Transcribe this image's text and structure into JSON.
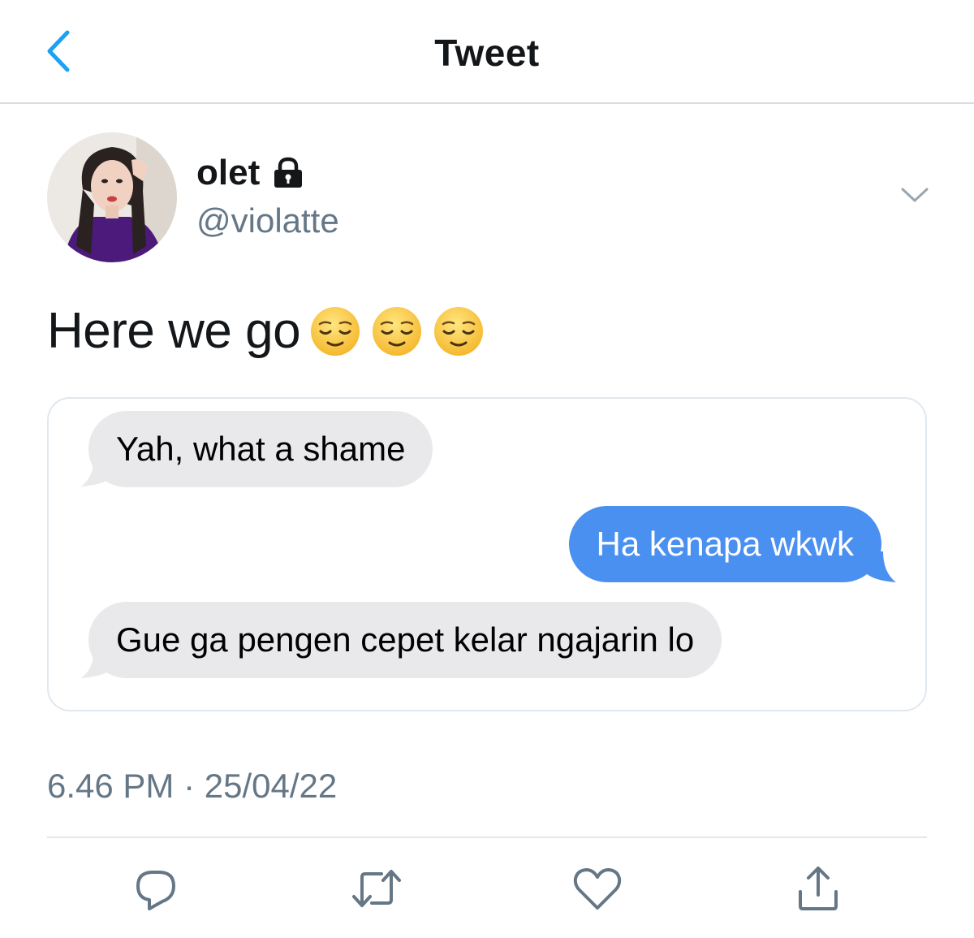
{
  "header": {
    "title": "Tweet",
    "back_icon": "chevron-left-icon"
  },
  "author": {
    "display_name": "olet",
    "handle": "@violatte",
    "lock_icon": "lock-icon",
    "menu_icon": "chevron-down-icon"
  },
  "tweet": {
    "text": "Here we go",
    "emojis": [
      "relieved-face-emoji",
      "relieved-face-emoji",
      "relieved-face-emoji"
    ]
  },
  "chat": {
    "messages": [
      {
        "direction": "incoming",
        "text": "Yah, what a shame"
      },
      {
        "direction": "outgoing",
        "text": "Ha kenapa wkwk"
      },
      {
        "direction": "incoming",
        "text": "Gue ga pengen cepet kelar ngajarin lo"
      }
    ]
  },
  "meta": {
    "time": "6.46 PM",
    "separator": "·",
    "date": "25/04/22"
  },
  "actions": [
    "reply-icon",
    "retweet-icon",
    "like-icon",
    "share-icon"
  ],
  "colors": {
    "accent": "#1da1f2",
    "secondary_text": "#657786",
    "outgoing_bubble": "#4a90f0",
    "incoming_bubble": "#e9e9eb",
    "emoji_yellow": "#f7c23a"
  }
}
